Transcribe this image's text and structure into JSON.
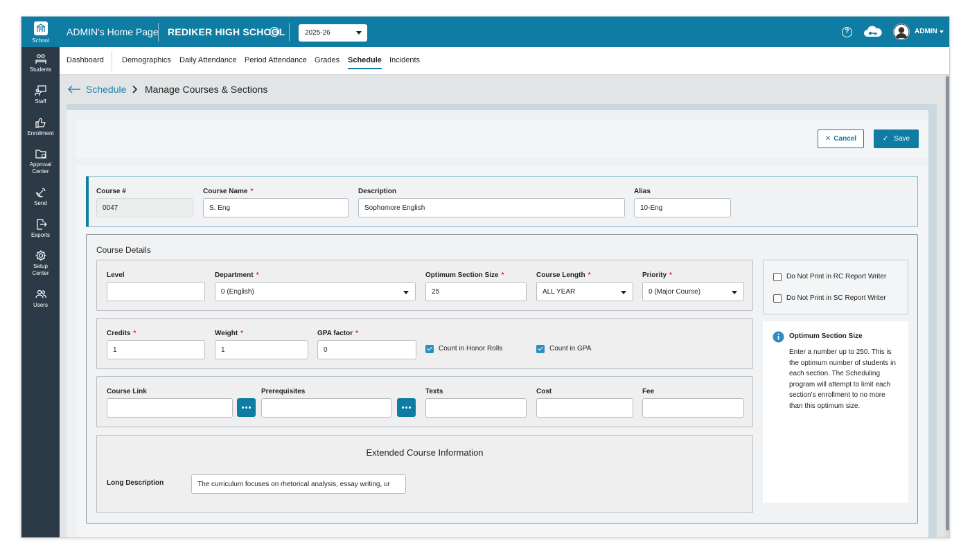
{
  "sidebar": {
    "items": [
      {
        "label": "School",
        "icon": "school-icon"
      },
      {
        "label": "Students",
        "icon": "students-icon"
      },
      {
        "label": "Staff",
        "icon": "staff-icon"
      },
      {
        "label": "Enrollment",
        "icon": "thumbs-up-icon"
      },
      {
        "label_line1": "Approval",
        "label_line2": "Center",
        "icon": "folder-icon"
      },
      {
        "label": "Send",
        "icon": "satellite-icon"
      },
      {
        "label": "Exports",
        "icon": "export-icon"
      },
      {
        "label_line1": "Setup",
        "label_line2": "Center",
        "icon": "gear-icon"
      },
      {
        "label": "Users",
        "icon": "users-icon"
      }
    ]
  },
  "header": {
    "home_title": "ADMIN's Home Page",
    "school_name": "REDIKER HIGH SCHOOL",
    "school_year": "2025-26",
    "user": "ADMIN",
    "accent_color": "#0f7ca3"
  },
  "tabs": {
    "dashboard": "Dashboard",
    "demographics": "Demographics",
    "daily_attendance": "Daily Attendance",
    "period_attendance": "Period Attendance",
    "grades": "Grades",
    "schedule": "Schedule",
    "incidents": "Incidents",
    "active": "Schedule"
  },
  "breadcrumb": {
    "parent": "Schedule",
    "current": "Manage Courses & Sections"
  },
  "actions": {
    "cancel": "Cancel",
    "save": "Save"
  },
  "course": {
    "number_label": "Course #",
    "number": "0047",
    "name_label": "Course Name",
    "name": "S. Eng",
    "description_label": "Description",
    "description": "Sophomore English",
    "alias_label": "Alias",
    "alias": "10-Eng"
  },
  "details": {
    "title": "Course Details",
    "level_label": "Level",
    "level": "",
    "department_label": "Department",
    "department": "0 (English)",
    "optimum_label": "Optimum Section Size",
    "optimum": "25",
    "length_label": "Course Length",
    "length": "ALL YEAR",
    "priority_label": "Priority",
    "priority": "0 (Major Course)",
    "credits_label": "Credits",
    "credits": "1",
    "weight_label": "Weight",
    "weight": "1",
    "gpa_factor_label": "GPA factor",
    "gpa_factor": "0",
    "honor_rolls_label": "Count in Honor Rolls",
    "honor_rolls_checked": true,
    "count_gpa_label": "Count in GPA",
    "count_gpa_checked": true,
    "course_link_label": "Course Link",
    "course_link": "",
    "prerequisites_label": "Prerequisites",
    "prerequisites": "",
    "texts_label": "Texts",
    "texts": "",
    "cost_label": "Cost",
    "cost": "",
    "fee_label": "Fee",
    "fee": ""
  },
  "extended": {
    "title": "Extended Course Information",
    "long_description_label": "Long Description",
    "long_description": "The curriculum focuses on rhetorical analysis, essay writing, ur"
  },
  "options": {
    "no_print_rc": "Do Not Print in RC Report Writer",
    "no_print_rc_checked": false,
    "no_print_sc": "Do Not Print in SC Report Writer",
    "no_print_sc_checked": false
  },
  "info": {
    "title": "Optimum Section Size",
    "text": "Enter a number up to 250. This is the optimum number of students in each section. The Scheduling program will attempt to limit each section's enrollment to no more than this optimum size."
  }
}
